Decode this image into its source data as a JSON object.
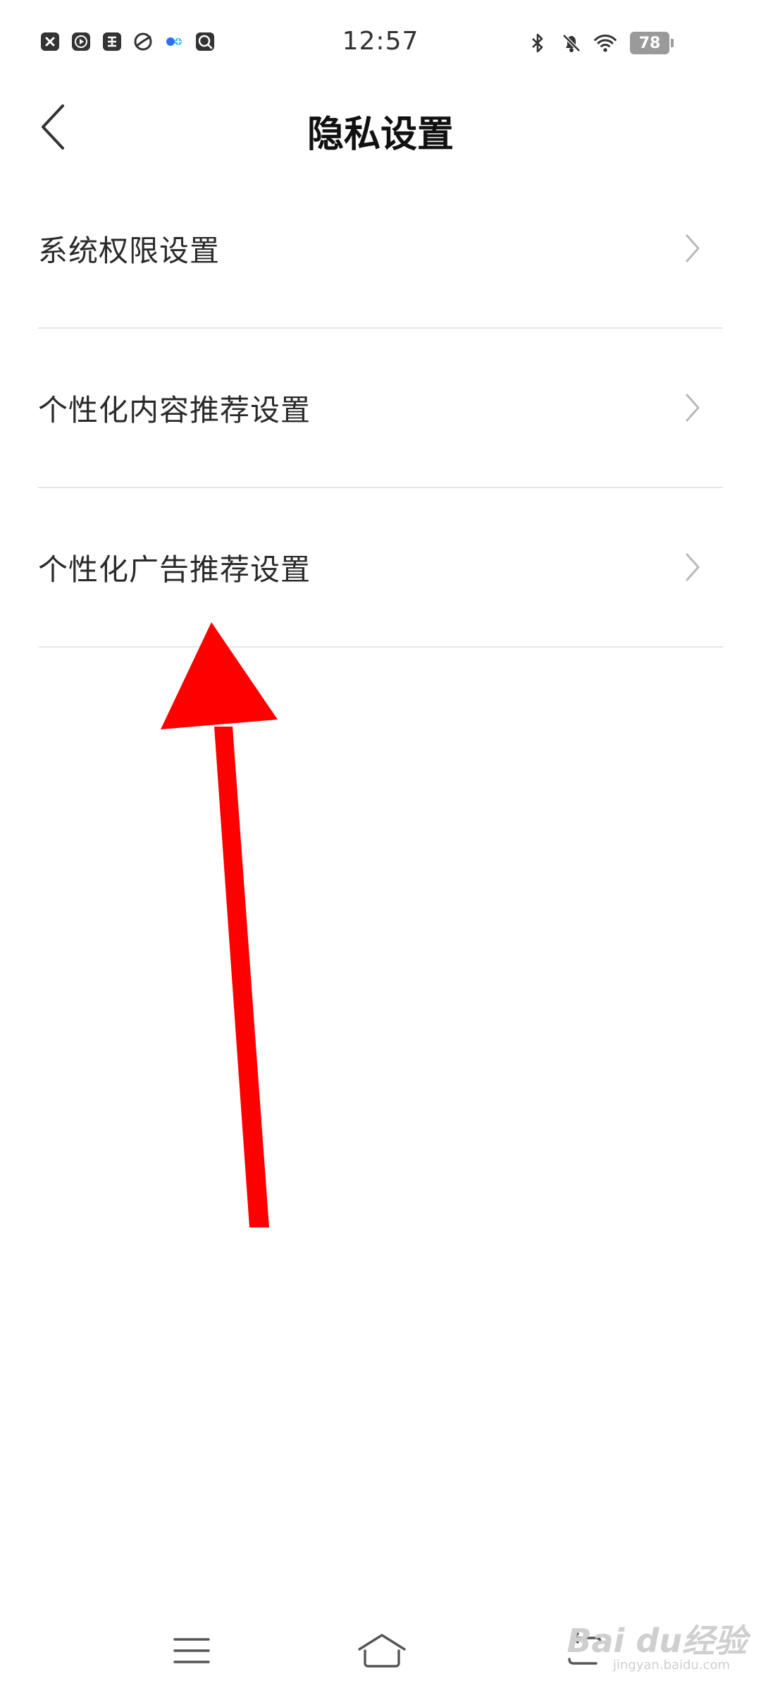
{
  "status_bar": {
    "time": "12:57",
    "battery_level": "78",
    "left_icons": [
      "close-app-icon",
      "video-play-icon",
      "sogou-search-icon",
      "browser-icon",
      "baidu-netdisk-icon",
      "du-search-icon"
    ],
    "right_icons": [
      "bluetooth-icon",
      "mute-bell-icon",
      "wifi-icon"
    ]
  },
  "header": {
    "title": "隐私设置",
    "back_icon": "chevron-left-icon"
  },
  "settings": {
    "items": [
      {
        "label": "系统权限设置"
      },
      {
        "label": "个性化内容推荐设置"
      },
      {
        "label": "个性化广告推荐设置"
      }
    ]
  },
  "annotation": {
    "color": "#ff0000",
    "shape": "arrow-up"
  },
  "nav_bar": {
    "menu_icon": "menu-icon",
    "home_icon": "home-icon",
    "back_icon": "return-icon"
  },
  "watermark": {
    "brand": "Bai du经验",
    "url": "jingyan.baidu.com"
  },
  "colors": {
    "text_primary": "#222222",
    "divider": "#e6e6e6",
    "chevron": "#b8b8b8",
    "status_icon": "#333333",
    "battery": "#9a9a9a"
  }
}
